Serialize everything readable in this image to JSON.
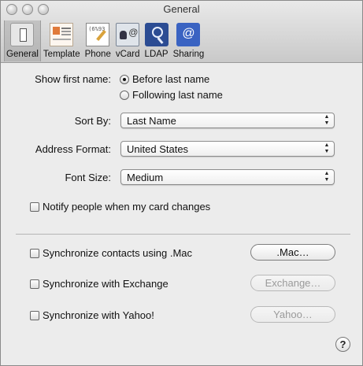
{
  "window": {
    "title": "General"
  },
  "toolbar": {
    "items": [
      {
        "label": "General",
        "icon": "general-switch-icon",
        "selected": true
      },
      {
        "label": "Template",
        "icon": "template-icon",
        "selected": false
      },
      {
        "label": "Phone",
        "icon": "phone-icon",
        "selected": false
      },
      {
        "label": "vCard",
        "icon": "vcard-icon",
        "selected": false
      },
      {
        "label": "LDAP",
        "icon": "ldap-icon",
        "selected": false
      },
      {
        "label": "Sharing",
        "icon": "sharing-icon",
        "selected": false
      }
    ]
  },
  "settings": {
    "show_first_name": {
      "label": "Show first name:",
      "options": [
        {
          "label": "Before last name",
          "selected": true
        },
        {
          "label": "Following last name",
          "selected": false
        }
      ]
    },
    "sort_by": {
      "label": "Sort By:",
      "value": "Last Name"
    },
    "address_format": {
      "label": "Address Format:",
      "value": "United States"
    },
    "font_size": {
      "label": "Font Size:",
      "value": "Medium"
    },
    "notify": {
      "label": "Notify people when my card changes",
      "checked": false
    }
  },
  "sync": {
    "mac": {
      "label": "Synchronize contacts using .Mac",
      "checked": false,
      "button": ".Mac…",
      "button_enabled": true
    },
    "exchange": {
      "label": "Synchronize with Exchange",
      "checked": false,
      "button": "Exchange…",
      "button_enabled": false
    },
    "yahoo": {
      "label": "Synchronize with Yahoo!",
      "checked": false,
      "button": "Yahoo…",
      "button_enabled": false
    }
  },
  "help": {
    "label": "?"
  }
}
